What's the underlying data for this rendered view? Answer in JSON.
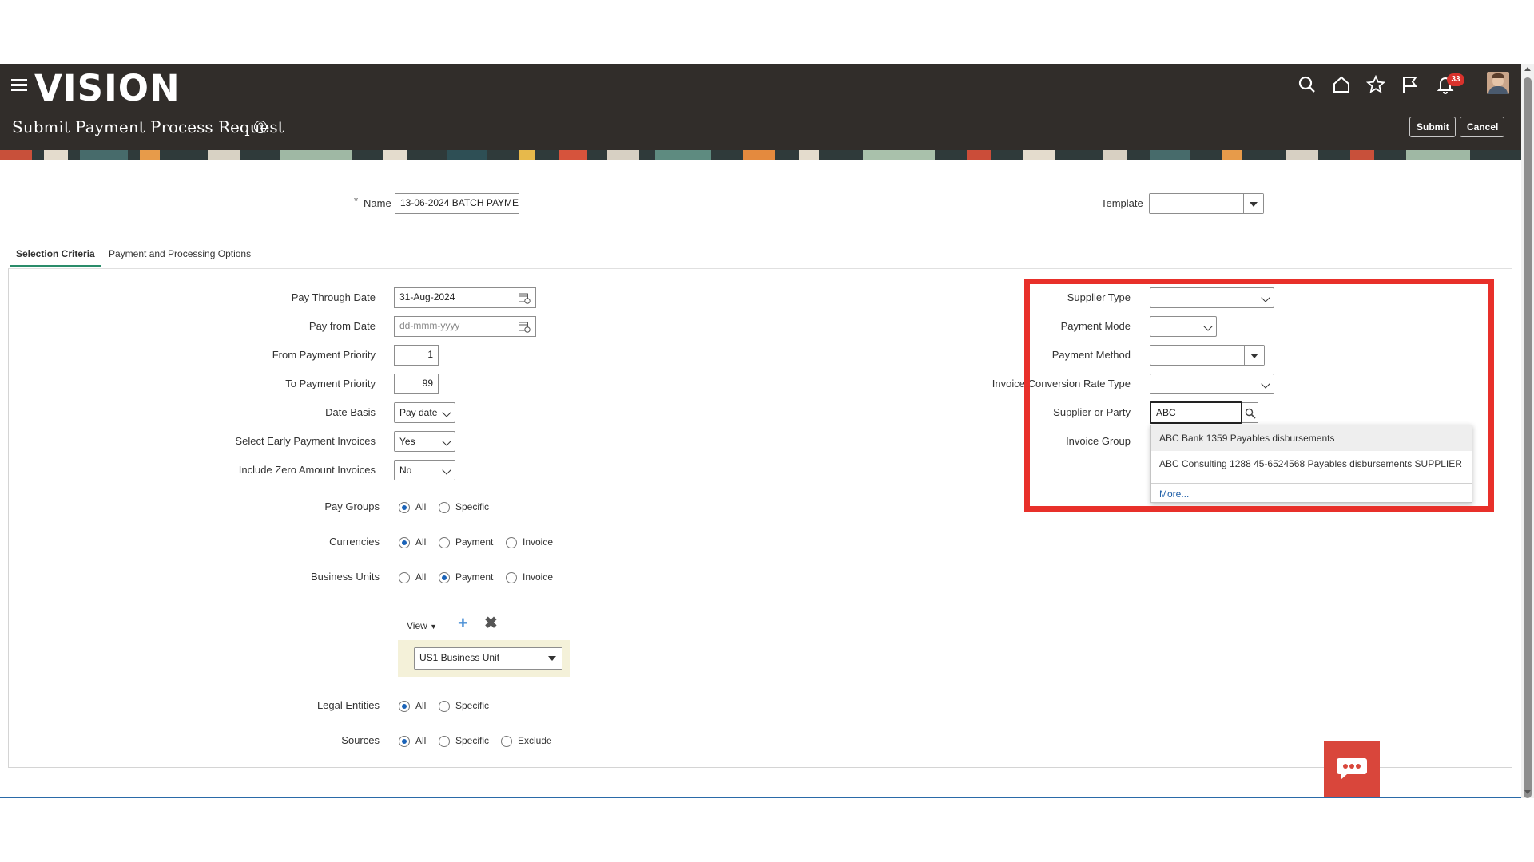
{
  "header": {
    "logo": "VISION",
    "page_title": "Submit Payment Process Request",
    "notification_count": "33",
    "submit_label": "Submit",
    "cancel_label": "Cancel"
  },
  "form": {
    "name_label": "Name",
    "required_mark": "*",
    "name_value": "13-06-2024 BATCH PAYME",
    "template_label": "Template",
    "template_value": ""
  },
  "tabs": [
    {
      "label": "Selection Criteria",
      "active": true
    },
    {
      "label": "Payment and Processing Options",
      "active": false
    }
  ],
  "left": {
    "pay_through_label": "Pay Through Date",
    "pay_through_value": "31-Aug-2024",
    "pay_from_label": "Pay from Date",
    "pay_from_placeholder": "dd-mmm-yyyy",
    "from_priority_label": "From Payment Priority",
    "from_priority_value": "1",
    "to_priority_label": "To Payment Priority",
    "to_priority_value": "99",
    "date_basis_label": "Date Basis",
    "date_basis_value": "Pay date",
    "early_label": "Select Early Payment Invoices",
    "early_value": "Yes",
    "zero_label": "Include Zero Amount Invoices",
    "zero_value": "No",
    "pay_groups_label": "Pay Groups",
    "currencies_label": "Currencies",
    "business_units_label": "Business Units",
    "legal_entities_label": "Legal Entities",
    "sources_label": "Sources",
    "opt_all": "All",
    "opt_specific": "Specific",
    "opt_payment": "Payment",
    "opt_invoice": "Invoice",
    "opt_exclude": "Exclude",
    "view_label": "View",
    "business_unit_value": "US1 Business Unit"
  },
  "right": {
    "supplier_type_label": "Supplier Type",
    "payment_mode_label": "Payment Mode",
    "payment_method_label": "Payment Method",
    "conversion_label": "Invoice Conversion Rate Type",
    "supplier_party_label": "Supplier or Party",
    "supplier_party_value": "ABC",
    "invoice_group_label": "Invoice Group"
  },
  "suggestions": {
    "items": [
      "ABC Bank 1359  Payables disbursements",
      "ABC Consulting 1288 45-6524568 Payables disbursements SUPPLIER"
    ],
    "more": "More..."
  },
  "colors": {
    "header_bg": "#312d2a",
    "highlight_box": "#e8302a",
    "radio_accent": "#1a63b8",
    "tab_underline": "#2a8c6a",
    "chat_button": "#d9463b"
  }
}
